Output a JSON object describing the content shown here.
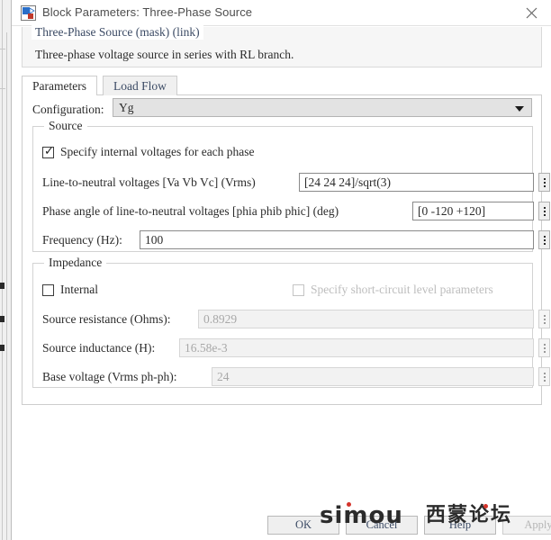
{
  "titlebar": {
    "title": "Block Parameters: Three-Phase Source",
    "icon": "simulink-block-icon",
    "close_label": "close-icon"
  },
  "description": {
    "legend": "Three-Phase Source (mask) (link)",
    "text": "Three-phase voltage source in series with RL branch."
  },
  "tabs": [
    {
      "label": "Parameters",
      "active": true
    },
    {
      "label": "Load Flow",
      "active": false
    }
  ],
  "configuration": {
    "label": "Configuration:",
    "value": "Yg",
    "arrow_icon": "chevron-down-icon"
  },
  "source_group": {
    "legend": "Source",
    "specify_internal": {
      "label": "Specify internal voltages for each phase",
      "checked": true
    },
    "fields": [
      {
        "label": "Line-to-neutral voltages [Va Vb Vc] (Vrms)",
        "value": "[24 24 24]/sqrt(3)",
        "disabled": false
      },
      {
        "label": "Phase angle of line-to-neutral voltages [phia phib phic] (deg)",
        "value": "[0 -120 +120]",
        "disabled": false
      },
      {
        "label": "Frequency (Hz):",
        "value": "100",
        "disabled": false
      }
    ]
  },
  "impedance_group": {
    "legend": "Impedance",
    "internal": {
      "label": "Internal",
      "checked": false
    },
    "short_circuit": {
      "label": "Specify short-circuit level parameters",
      "checked": false,
      "disabled": true
    },
    "fields": [
      {
        "label": "Source resistance (Ohms):",
        "value": "0.8929",
        "disabled": true
      },
      {
        "label": "Source inductance (H):",
        "value": "16.58e-3",
        "disabled": true
      },
      {
        "label": "Base voltage (Vrms ph-ph):",
        "value": "24",
        "disabled": true
      }
    ]
  },
  "buttons": [
    {
      "label": "OK",
      "disabled": false
    },
    {
      "label": "Cancel",
      "disabled": false
    },
    {
      "label": "Help",
      "disabled": false
    },
    {
      "label": "Apply",
      "disabled": true
    }
  ],
  "watermark": {
    "latin": "simou",
    "cjk": "西蒙论坛",
    "accent_color": "#d4342b"
  }
}
